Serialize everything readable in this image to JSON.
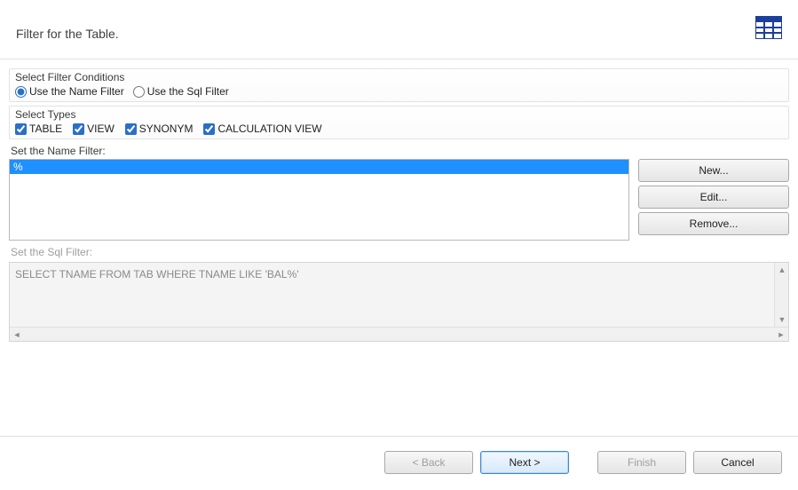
{
  "header": {
    "title": "Filter for the Table."
  },
  "filterConditions": {
    "title": "Select Filter Conditions",
    "options": {
      "name": "Use the Name Filter",
      "sql": "Use the Sql Filter"
    },
    "selected": "name"
  },
  "types": {
    "title": "Select Types",
    "items": [
      {
        "key": "table",
        "label": "TABLE",
        "checked": true
      },
      {
        "key": "view",
        "label": "VIEW",
        "checked": true
      },
      {
        "key": "synonym",
        "label": "SYNONYM",
        "checked": true
      },
      {
        "key": "calcview",
        "label": "CALCULATION VIEW",
        "checked": true
      }
    ]
  },
  "nameFilter": {
    "label": "Set the Name Filter:",
    "items": [
      "%"
    ],
    "selectedIndex": 0,
    "buttons": {
      "new": "New...",
      "edit": "Edit...",
      "remove": "Remove..."
    }
  },
  "sqlFilter": {
    "label": "Set the Sql Filter:",
    "text": "SELECT TNAME FROM TAB WHERE TNAME LIKE 'BAL%'",
    "enabled": false
  },
  "footer": {
    "back": "< Back",
    "next": "Next >",
    "finish": "Finish",
    "cancel": "Cancel"
  }
}
